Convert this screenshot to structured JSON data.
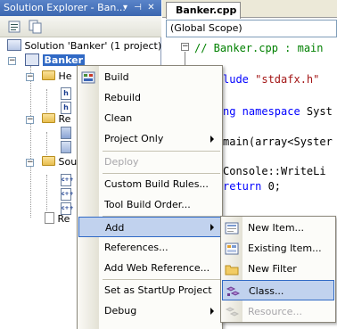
{
  "solution_explorer": {
    "title": "Solution Explorer - Ban...",
    "title_buttons": [
      "▾",
      "⊣",
      "✕"
    ],
    "tree": {
      "solution": "Solution 'Banker' (1 project)",
      "project": "Banker",
      "folders": [
        {
          "label": "He",
          "children": [
            "h",
            "h"
          ]
        },
        {
          "label": "Re",
          "children": [
            "",
            ""
          ]
        },
        {
          "label": "Sou",
          "children": [
            "c++",
            "c++",
            "c++"
          ]
        }
      ],
      "readme": "Re"
    }
  },
  "editor": {
    "tab": "Banker.cpp",
    "scope": "(Global Scope)",
    "lines": [
      {
        "parts": [
          {
            "t": "// Banker.cpp : main",
            "c": "comment"
          }
        ]
      },
      {
        "parts": [
          {
            "t": "lude ",
            "c": "keyword"
          },
          {
            "t": "\"stdafx.h\"",
            "c": "string"
          }
        ]
      },
      {
        "parts": [
          {
            "t": "ng namespace ",
            "c": "keyword"
          },
          {
            "t": "Syst",
            "c": "plain"
          }
        ]
      },
      {
        "parts": [
          {
            "t": "main(array<Syster",
            "c": "plain"
          }
        ]
      },
      {
        "parts": [
          {
            "t": "Console::WriteLi",
            "c": "plain"
          }
        ]
      },
      {
        "parts": [
          {
            "t": "return ",
            "c": "keyword"
          },
          {
            "t": "0;",
            "c": "plain"
          }
        ]
      }
    ],
    "colors": {
      "comment": "#008000",
      "keyword": "#0000ff",
      "string": "#a31515",
      "plain": "#000000"
    }
  },
  "context_menu": {
    "items": [
      {
        "label": "Build",
        "icon": "build-icon"
      },
      {
        "label": "Rebuild"
      },
      {
        "label": "Clean"
      },
      {
        "label": "Project Only",
        "submenu": true
      },
      {
        "label": "Deploy",
        "disabled": true
      },
      {
        "label": "Custom Build Rules..."
      },
      {
        "label": "Tool Build Order..."
      },
      {
        "label": "Add",
        "submenu": true,
        "highlighted": true
      },
      {
        "label": "References..."
      },
      {
        "label": "Add Web Reference..."
      },
      {
        "label": "Set as StartUp Project"
      },
      {
        "label": "Debug",
        "submenu": true
      }
    ]
  },
  "add_submenu": {
    "items": [
      {
        "label": "New Item...",
        "icon": "new-item-icon"
      },
      {
        "label": "Existing Item...",
        "icon": "existing-item-icon"
      },
      {
        "label": "New Filter",
        "icon": "folder-icon"
      },
      {
        "label": "Class...",
        "icon": "class-icon",
        "highlighted": true
      },
      {
        "label": "Resource...",
        "icon": "resource-icon",
        "disabled": true
      }
    ]
  }
}
